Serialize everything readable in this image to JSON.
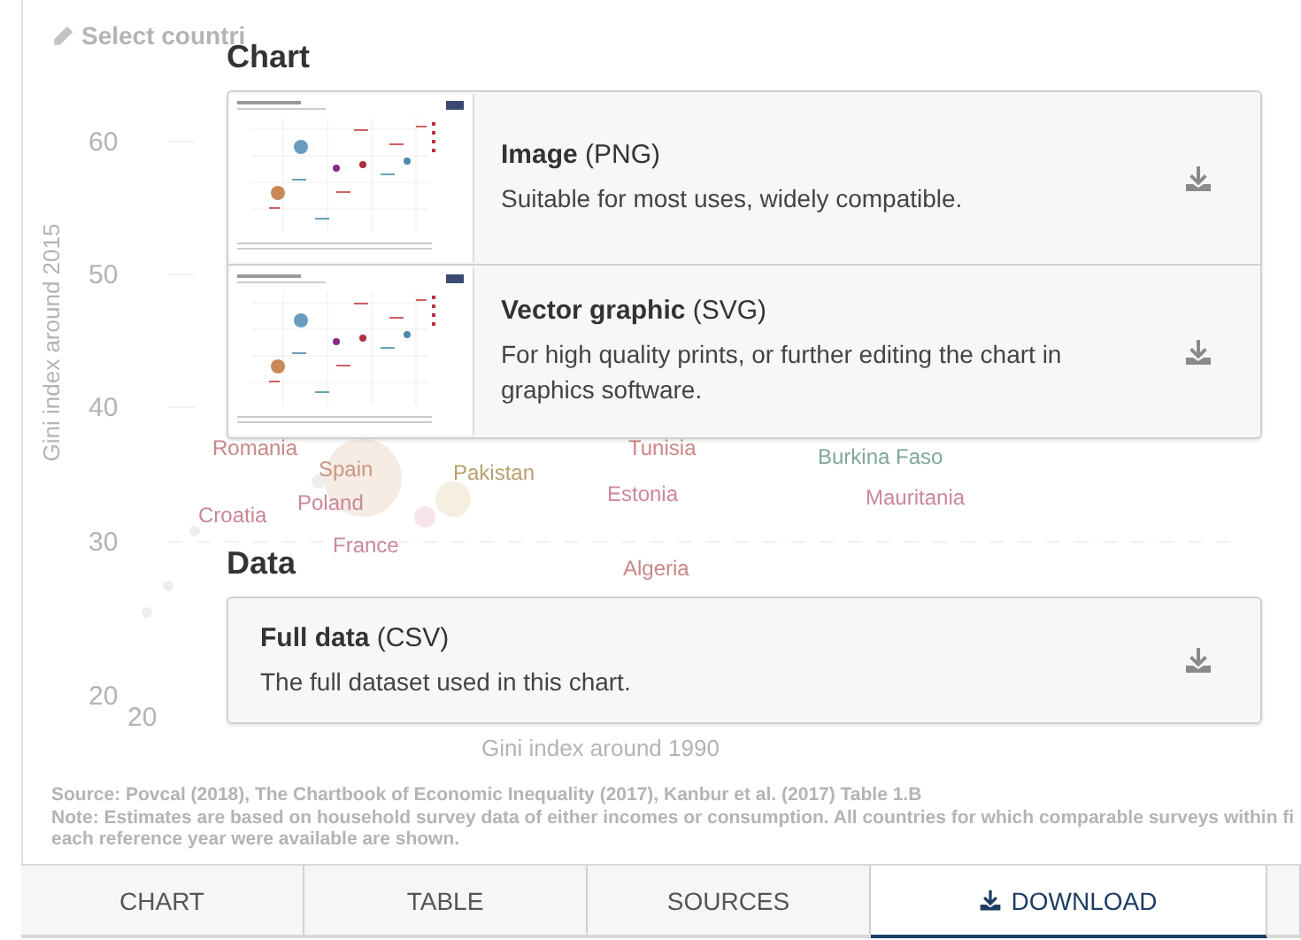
{
  "background_chart": {
    "select_button": "Select countri",
    "y_axis_title": "Gini index around 2015",
    "x_axis_title": "Gini index around 1990",
    "y_ticks": [
      "60",
      "50",
      "40",
      "30",
      "20"
    ],
    "x_ticks": [
      "20"
    ],
    "point_labels": [
      {
        "label": "Romania",
        "color": "#c98888"
      },
      {
        "label": "Spain",
        "color": "#c99880"
      },
      {
        "label": "Pakistan",
        "color": "#b8a070"
      },
      {
        "label": "Poland",
        "color": "#c98898"
      },
      {
        "label": "Croatia",
        "color": "#c98898"
      },
      {
        "label": "France",
        "color": "#c98898"
      },
      {
        "label": "Tunisia",
        "color": "#c98888"
      },
      {
        "label": "Estonia",
        "color": "#c98898"
      },
      {
        "label": "Algeria",
        "color": "#c98888"
      },
      {
        "label": "Burkina Faso",
        "color": "#7fa898"
      },
      {
        "label": "Mauritania",
        "color": "#c98898"
      }
    ],
    "source": "Source: Povcal (2018), The Chartbook of Economic Inequality (2017), Kanbur et al. (2017) Table 1.B",
    "note": "Note: Estimates are based on household survey data of either incomes or consumption. All countries for which comparable surveys within fi",
    "note_line_2": "each reference year were available are shown."
  },
  "sections": [
    {
      "title": "Chart",
      "options": [
        {
          "kind": "image",
          "name": "Image",
          "format": "(PNG)",
          "description": "Suitable for most uses, widely compatible."
        },
        {
          "kind": "image",
          "name": "Vector graphic",
          "format": "(SVG)",
          "description": "For high quality prints, or further editing the chart in graphics software."
        }
      ]
    },
    {
      "title": "Data",
      "options": [
        {
          "kind": "file",
          "name": "Full data",
          "format": "(CSV)",
          "description": "The full dataset used in this chart."
        }
      ]
    }
  ],
  "tabs": [
    {
      "label": "CHART",
      "selected": false,
      "download_icon": false
    },
    {
      "label": "TABLE",
      "selected": false,
      "download_icon": false
    },
    {
      "label": "SOURCES",
      "selected": false,
      "download_icon": false
    },
    {
      "label": "DOWNLOAD",
      "selected": true,
      "download_icon": true
    }
  ]
}
